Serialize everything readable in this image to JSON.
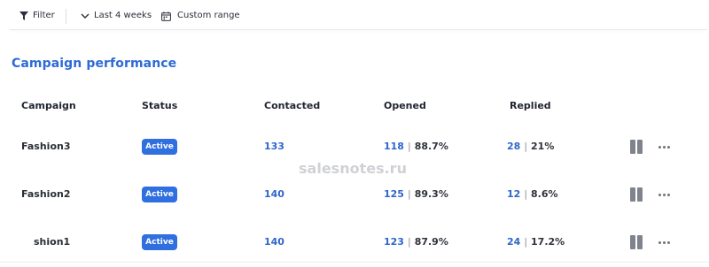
{
  "toolbar": {
    "filter_label": "Filter",
    "period_label": "Last 4 weeks",
    "range_label": "Custom range"
  },
  "section": {
    "title": "Campaign performance"
  },
  "table": {
    "columns": [
      "Campaign",
      "Status",
      "Contacted",
      "Opened",
      "Replied"
    ],
    "rows": [
      {
        "campaign": "Fashion3",
        "status": "Active",
        "contacted": "133",
        "opened_count": "118",
        "opened_pct": "88.7%",
        "replied_count": "28",
        "replied_pct": "21%"
      },
      {
        "campaign": "Fashion2",
        "status": "Active",
        "contacted": "140",
        "opened_count": "125",
        "opened_pct": "89.3%",
        "replied_count": "12",
        "replied_pct": "8.6%"
      },
      {
        "campaign": "shion1",
        "status": "Active",
        "contacted": "140",
        "opened_count": "123",
        "opened_pct": "87.9%",
        "replied_count": "24",
        "replied_pct": "17.2%"
      }
    ]
  },
  "watermark": "salesnotes.ru",
  "icons": {
    "filter": "filter-icon",
    "period": "chevron-down-icon",
    "range": "calendar-icon",
    "pause": "pause-icon",
    "more": "more-icon"
  },
  "colors": {
    "accent": "#2e6bd6",
    "badge": "#2f6fe0",
    "link": "#2e66cc"
  }
}
